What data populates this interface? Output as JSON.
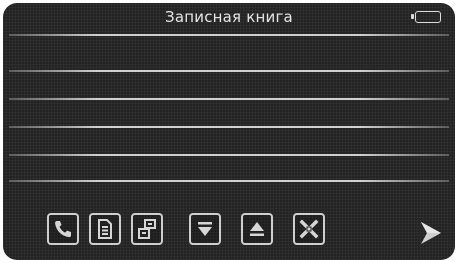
{
  "header": {
    "title": "Записная книга",
    "battery_icon": "battery-icon"
  },
  "entries": [
    "",
    "",
    "",
    "",
    "",
    ""
  ],
  "toolbar": {
    "buttons": [
      {
        "name": "phone-button",
        "icon": "phone-icon"
      },
      {
        "name": "details-button",
        "icon": "document-icon"
      },
      {
        "name": "edit-button",
        "icon": "edit-icon"
      },
      {
        "name": "sort-down-button",
        "icon": "arrow-down-icon"
      },
      {
        "name": "sort-up-button",
        "icon": "arrow-up-icon"
      },
      {
        "name": "delete-button",
        "icon": "delete-x-icon"
      }
    ],
    "next_icon": "next-page-arrow-icon"
  },
  "colors": {
    "background": "#232323",
    "foreground": "#e6e6e6",
    "line": "#e1e1e1"
  }
}
